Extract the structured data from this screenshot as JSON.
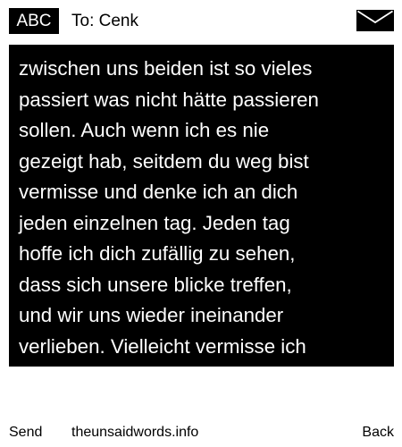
{
  "header": {
    "input_mode": "ABC",
    "recipient": "To: Cenk",
    "icon": "envelope-icon"
  },
  "message": {
    "text": "zwischen uns beiden ist so vieles\npassiert was nicht hätte passieren\nsollen. Auch wenn ich es nie\ngezeigt hab, seitdem du weg bist\nvermisse und denke ich an dich\njeden einzelnen tag. Jeden tag\nhoffe ich dich zufällig zu sehen,\ndass sich unsere blicke treffen,\nund wir uns wieder ineinander\nverlieben. Vielleicht vermisse ich"
  },
  "footer": {
    "send_label": "Send",
    "site_label": "theunsaidwords.info",
    "back_label": "Back"
  },
  "colors": {
    "background": "#ffffff",
    "foreground": "#000000",
    "inverse_text": "#ffffff"
  }
}
